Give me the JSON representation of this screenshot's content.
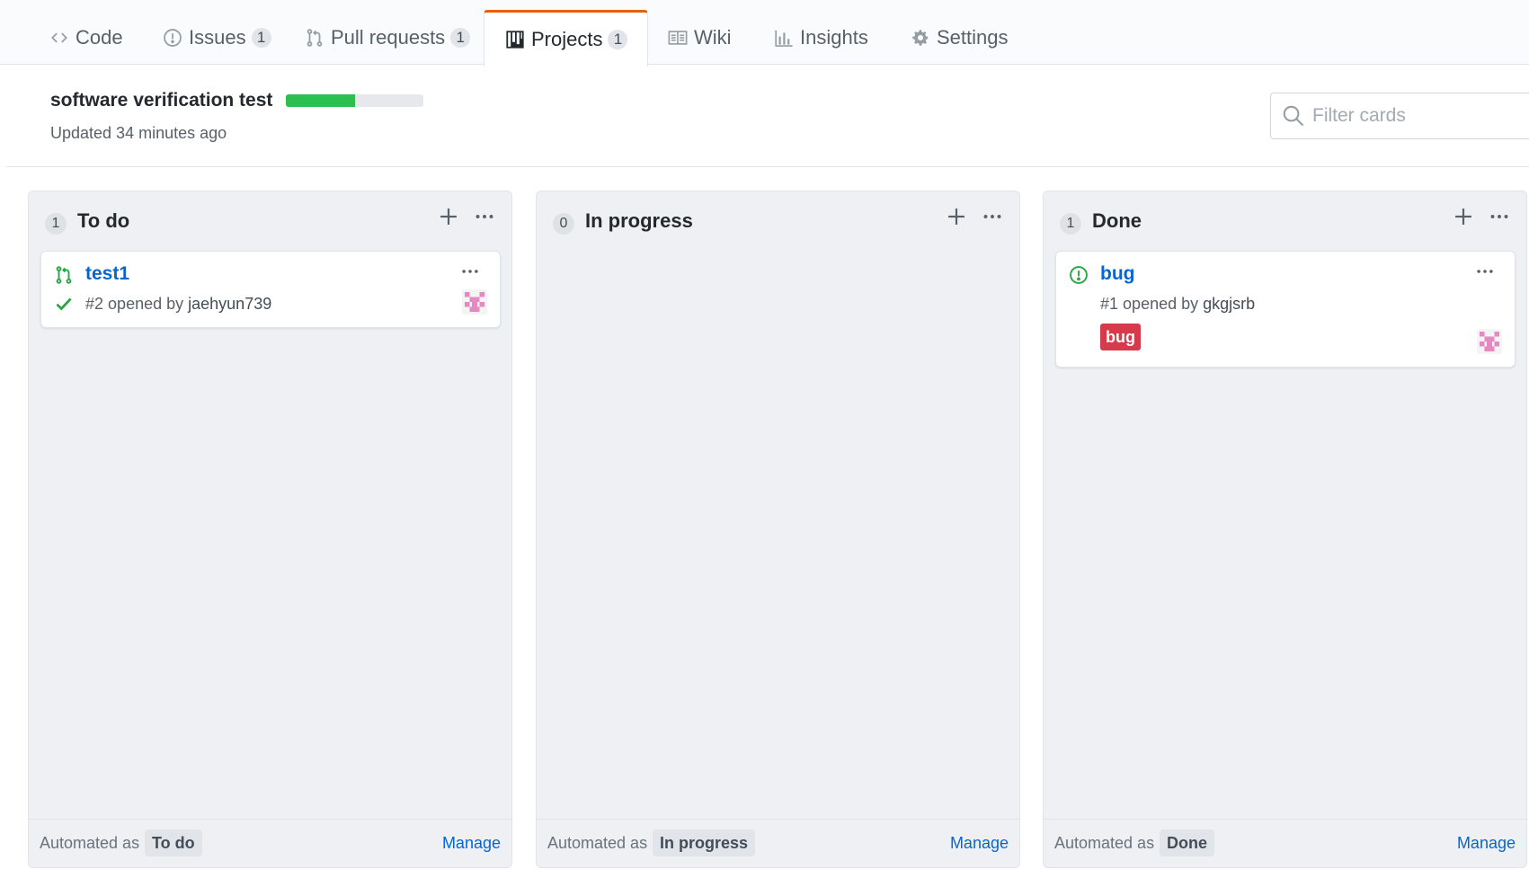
{
  "tabs": [
    {
      "label": "Code",
      "icon": "code-icon"
    },
    {
      "label": "Issues",
      "count": "1",
      "icon": "issue-opened-icon"
    },
    {
      "label": "Pull requests",
      "count": "1",
      "icon": "git-pull-request-icon"
    },
    {
      "label": "Projects",
      "count": "1",
      "icon": "project-icon",
      "active": true
    },
    {
      "label": "Wiki",
      "icon": "book-icon"
    },
    {
      "label": "Insights",
      "icon": "graph-icon"
    },
    {
      "label": "Settings",
      "icon": "gear-icon"
    }
  ],
  "project": {
    "title": "software verification test",
    "updated": "Updated 34 minutes ago",
    "progress_percent": 50
  },
  "filter": {
    "placeholder": "Filter cards",
    "value": ""
  },
  "columns": [
    {
      "count": "1",
      "name": "To do",
      "automated_label": "Automated as",
      "automated_value": "To do",
      "manage_label": "Manage",
      "cards": [
        {
          "type": "pull-request",
          "title": "test1",
          "number": "#2",
          "opened_by": "opened by",
          "user": "jaehyun739",
          "status": "check"
        }
      ]
    },
    {
      "count": "0",
      "name": "In progress",
      "automated_label": "Automated as",
      "automated_value": "In progress",
      "manage_label": "Manage",
      "cards": []
    },
    {
      "count": "1",
      "name": "Done",
      "automated_label": "Automated as",
      "automated_value": "Done",
      "manage_label": "Manage",
      "cards": [
        {
          "type": "issue",
          "title": "bug",
          "number": "#1",
          "opened_by": "opened by",
          "user": "gkgjsrb",
          "label": "bug",
          "label_color": "#d73a4a"
        }
      ]
    }
  ],
  "colors": {
    "accent": "#0366d6",
    "active_tab": "#e36209",
    "progress_fill": "#2cbe4e",
    "success": "#28a745",
    "avatar": "#e589c3"
  }
}
